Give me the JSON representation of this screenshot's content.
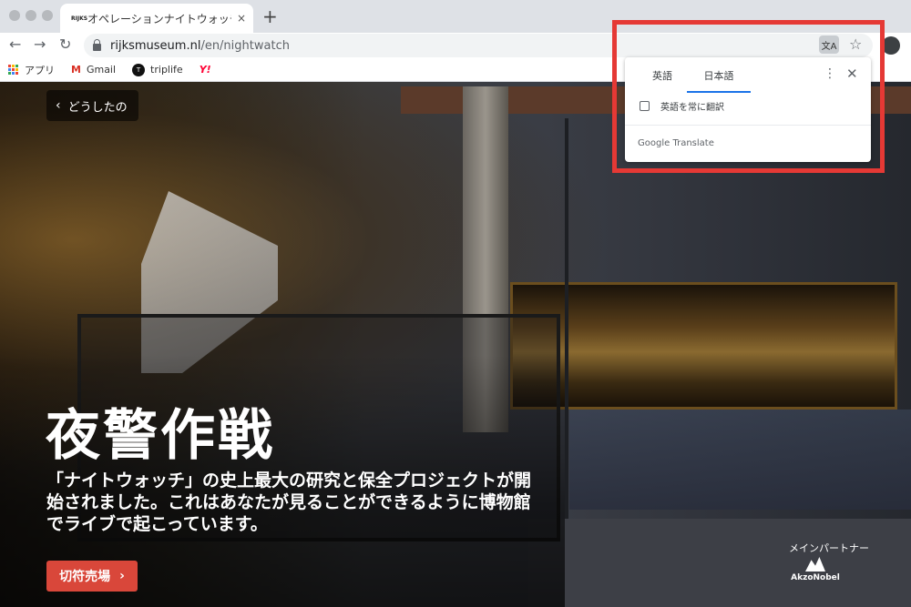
{
  "browser": {
    "tab": {
      "favicon_text": "RIJKS",
      "title": "オペレーションナイトウォッチ -",
      "close": "×"
    },
    "new_tab": "+",
    "address": {
      "domain": "rijksmuseum.nl",
      "path": "/en/nightwatch"
    },
    "bookmarks": [
      {
        "label": "アプリ",
        "icon": "apps-grid-icon"
      },
      {
        "label": "Gmail",
        "icon": "gmail-icon",
        "icon_glyph": "M"
      },
      {
        "label": "triplife",
        "icon": "triplife-icon",
        "icon_glyph": "T"
      },
      {
        "label": "Y!",
        "icon": "yahoo-icon",
        "icon_glyph": "Y!"
      }
    ],
    "apps_grid_colors": [
      "#ea4335",
      "#fbbc04",
      "#34a853",
      "#4285f4",
      "#ea4335",
      "#fbbc04",
      "#34a853",
      "#4285f4",
      "#ea4335"
    ]
  },
  "translate_popup": {
    "tab_source": "英語",
    "tab_target": "日本語",
    "always_translate": "英語を常に翻訳",
    "brand": "Google Translate",
    "highlight_color": "#e53935"
  },
  "page": {
    "back_label": "どうしたの",
    "hero_title": "夜警作戦",
    "hero_description": "「ナイトウォッチ」の史上最大の研究と保全プロジェクトが開始されました。これはあなたが見ることができるように博物館でライブで起こっています。",
    "ticket_button": "切符売場",
    "ticket_color": "#d9473a",
    "partner_label": "メインパートナー",
    "partner_name": "AkzoNobel"
  }
}
